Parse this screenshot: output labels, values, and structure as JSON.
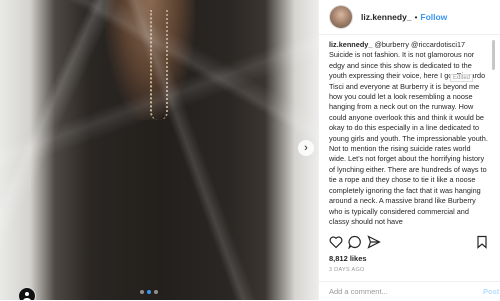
{
  "post": {
    "username": "liz.kennedy_",
    "separator": "•",
    "follow_label": "Follow",
    "caption_user": "liz.kennedy_",
    "caption_text": "@burberry @riccardotisci17 Suicide is not fashion. It is not glamorous nor edgy and since this show is dedicated to the youth expressing their voice, here I go. Riccardo Tisci and everyone at Burberry it is beyond me how you could let a look resembling a noose hanging from a neck out on the runway. How could anyone overlook this and think it would be okay to do this especially in a line dedicated to young girls and youth. The impressionable youth. Not to mention the rising suicide rates world wide. Let's not forget about the horrifying history of lynching either. There are hundreds of ways to tie a rope and they chose to tie it like a noose completely ignoring the fact that it was hanging around a neck. A massive brand like Burberry who is typically considered commercial and classy should not have",
    "edited_label": "Edited",
    "likes": "8,812 likes",
    "timestamp": "3 DAYS AGO",
    "comment_placeholder": "Add a comment...",
    "post_label": "Post",
    "carousel": {
      "count": 3,
      "active_index": 1,
      "next_glyph": "›"
    }
  },
  "colors": {
    "link_blue": "#3897f0",
    "text": "#262626",
    "muted": "#999999"
  },
  "icons": [
    "heart-icon",
    "comment-icon",
    "share-icon",
    "bookmark-icon",
    "chevron-right-icon"
  ]
}
